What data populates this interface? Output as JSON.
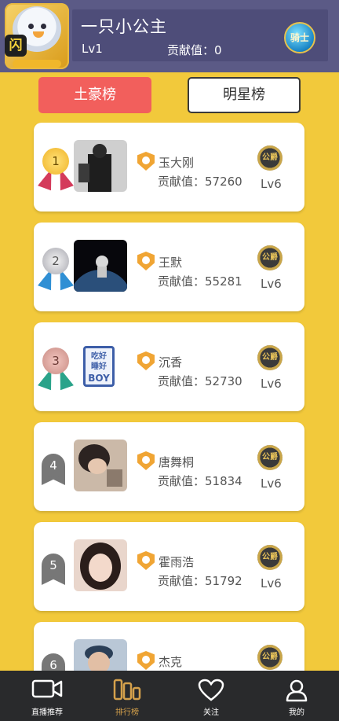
{
  "header": {
    "avatar_badge": "闪",
    "username": "一只小公主",
    "level": "Lv1",
    "contribution_text": "贡献值：0",
    "knight_badge": "骑士"
  },
  "tabs": [
    {
      "label": "土豪榜",
      "active": true
    },
    {
      "label": "明星榜",
      "active": false
    }
  ],
  "ranking": [
    {
      "rank": "1",
      "name": "玉大刚",
      "score_text": "贡献值：57260",
      "level": "Lv6",
      "rank_badge": "公爵"
    },
    {
      "rank": "2",
      "name": "王默",
      "score_text": "贡献值：55281",
      "level": "Lv6",
      "rank_badge": "公爵"
    },
    {
      "rank": "3",
      "name": "沉香",
      "score_text": "贡献值：52730",
      "level": "Lv6",
      "rank_badge": "公爵",
      "photo_text": [
        "吃好",
        "睡好",
        "BOY"
      ]
    },
    {
      "rank": "4",
      "name": "唐舞桐",
      "score_text": "贡献值：51834",
      "level": "Lv6",
      "rank_badge": "公爵"
    },
    {
      "rank": "5",
      "name": "霍雨浩",
      "score_text": "贡献值：51792",
      "level": "Lv6",
      "rank_badge": "公爵"
    },
    {
      "rank": "6",
      "name": "杰克",
      "score_text": "",
      "level": "",
      "rank_badge": "公爵"
    }
  ],
  "nav": [
    {
      "label": "直播推荐",
      "icon": "camera-icon",
      "active": false
    },
    {
      "label": "排行榜",
      "icon": "ranking-bars-icon",
      "active": true
    },
    {
      "label": "关注",
      "icon": "heart-icon",
      "active": false
    },
    {
      "label": "我的",
      "icon": "user-icon",
      "active": false
    }
  ],
  "colors": {
    "background": "#f2c93b",
    "header": "#5b5a86",
    "active_tab": "#f25f5c",
    "nav_bg": "#292a2c",
    "nav_active": "#d4a04b"
  }
}
